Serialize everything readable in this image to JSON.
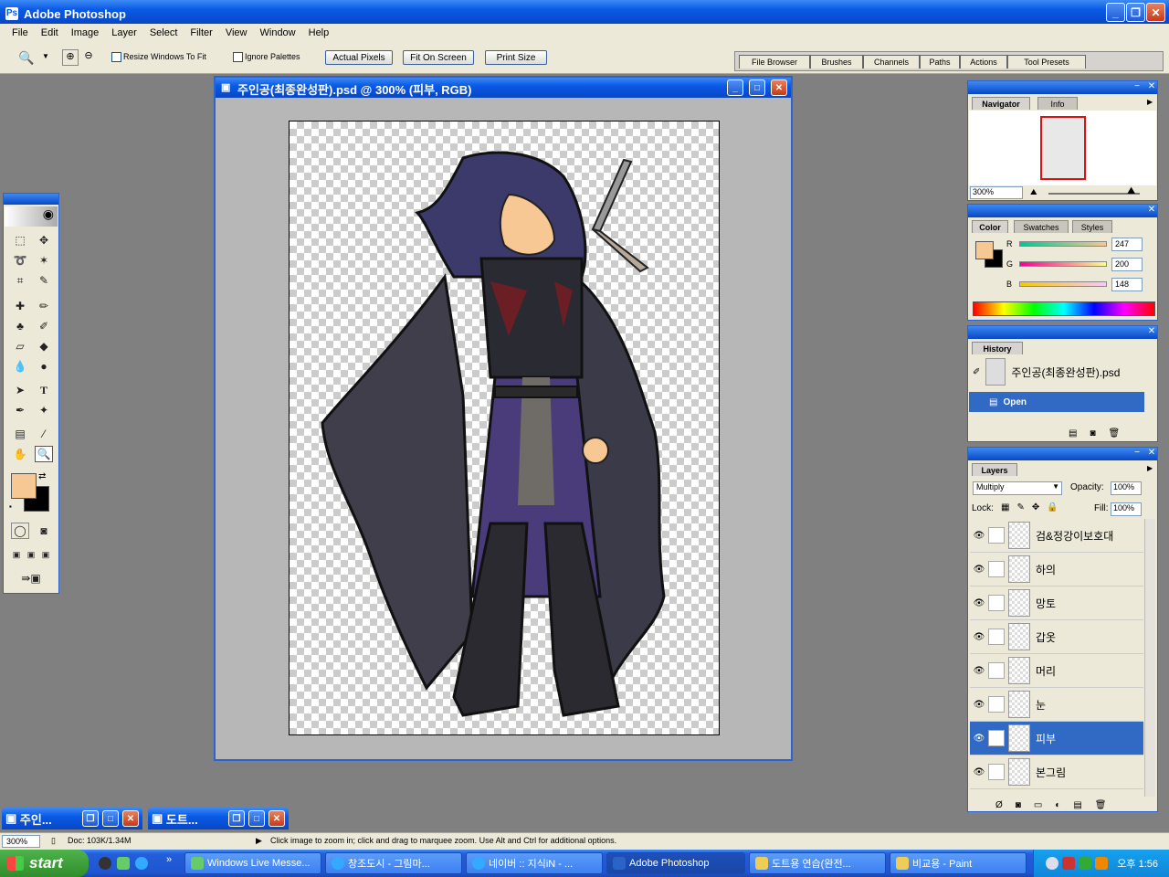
{
  "app": {
    "title": "Adobe Photoshop",
    "window_buttons": {
      "minimize": "_",
      "restore": "❐",
      "close": "✕"
    }
  },
  "menu": [
    "File",
    "Edit",
    "Image",
    "Layer",
    "Select",
    "Filter",
    "View",
    "Window",
    "Help"
  ],
  "options_bar": {
    "resize_windows_label": "Resize Windows To Fit",
    "ignore_palettes_label": "Ignore Palettes",
    "actual_pixels": "Actual Pixels",
    "fit_on_screen": "Fit On Screen",
    "print_size": "Print Size"
  },
  "palette_well": [
    "File Browser",
    "Brushes",
    "Channels",
    "Paths",
    "Actions",
    "Tool Presets"
  ],
  "document": {
    "title": "주인공(최종완성판).psd @ 300% (피부, RGB)"
  },
  "navigator": {
    "tabs": [
      "Navigator",
      "Info"
    ],
    "zoom": "300%"
  },
  "color": {
    "tabs": [
      "Color",
      "Swatches",
      "Styles"
    ],
    "channels": [
      {
        "label": "R",
        "value": "247"
      },
      {
        "label": "G",
        "value": "200"
      },
      {
        "label": "B",
        "value": "148"
      }
    ],
    "foreground": "#f7c894",
    "background": "#000000"
  },
  "history": {
    "tab": "History",
    "snapshot": "주인공(최종완성판).psd",
    "states": [
      "Open"
    ]
  },
  "layers": {
    "tab": "Layers",
    "blend_mode": "Multiply",
    "opacity_label": "Opacity:",
    "opacity": "100%",
    "lock_label": "Lock:",
    "fill_label": "Fill:",
    "fill": "100%",
    "items": [
      {
        "name": "검&정강이보호대",
        "selected": false
      },
      {
        "name": "하의",
        "selected": false
      },
      {
        "name": "망토",
        "selected": false
      },
      {
        "name": "갑옷",
        "selected": false
      },
      {
        "name": "머리",
        "selected": false
      },
      {
        "name": "눈",
        "selected": false
      },
      {
        "name": "피부",
        "selected": true
      },
      {
        "name": "본그림",
        "selected": false
      }
    ]
  },
  "minimized_windows": [
    "주인...",
    "도트..."
  ],
  "status_bar": {
    "zoom": "300%",
    "doc_size": "Doc: 103K/1.34M",
    "hint": "Click image to zoom in; click and drag to marquee zoom.  Use Alt and Ctrl for additional options."
  },
  "taskbar": {
    "start": "start",
    "quick_more": "»",
    "tasks": [
      {
        "label": "Windows Live Messe...",
        "active": false
      },
      {
        "label": "창조도시 - 그림마...",
        "active": false
      },
      {
        "label": "네이버 :: 지식iN - ...",
        "active": false
      },
      {
        "label": "Adobe Photoshop",
        "active": true
      },
      {
        "label": "도트용 연습(완전...",
        "active": false
      },
      {
        "label": "비교용 - Paint",
        "active": false
      }
    ],
    "clock": "오후 1:56"
  }
}
